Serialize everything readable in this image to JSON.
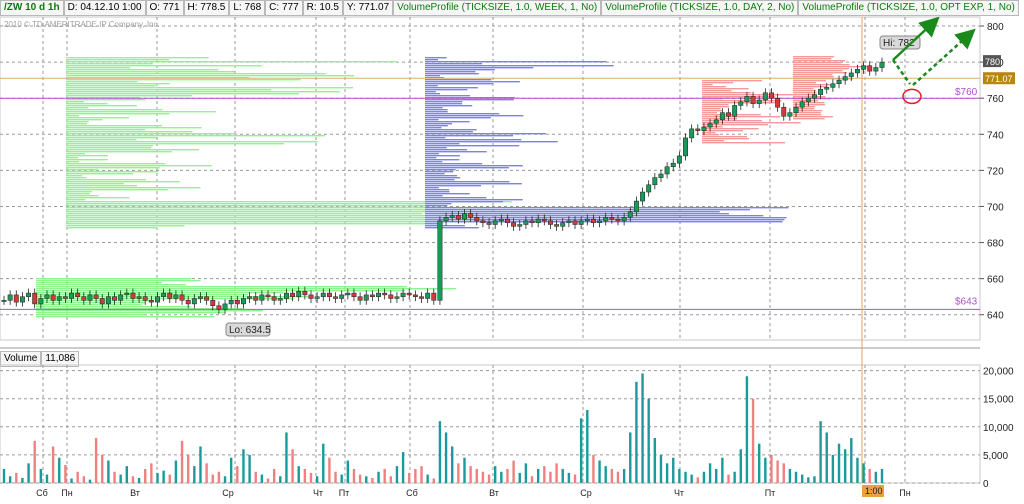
{
  "header": {
    "symbol": "/ZW 10 d 1h",
    "date": "D: 04.12.10 1:00",
    "open": "O: 771",
    "high": "H: 778.5",
    "low": "L: 768",
    "close": "C: 777",
    "range": "R: 10.5",
    "y": "Y: 771.07",
    "studies": [
      "VolumeProfile (TICKSIZE, 1.0, WEEK, 1, No)",
      "VolumeProfile (TICKSIZE, 1.0, DAY, 2, No)",
      "VolumeProfile (TICKSIZE, 1.0, OPT EXP, 1, No)"
    ]
  },
  "watermark": "2010 © TD AMERITRADE IP Company, Inc.",
  "volume_header": {
    "label": "Volume",
    "value": "11,086"
  },
  "annotations": {
    "hi_label": "Hi: 782",
    "lo_label": "Lo: 634.5",
    "price_badge": "771.07",
    "last_badge": "780",
    "level_760": "$760",
    "level_643": "$643",
    "time_badge": "1:00"
  },
  "colors": {
    "green_profile": "#8ef58e",
    "blue_profile": "#7f7ff0",
    "red_profile": "#f59a9a",
    "candle_up": "#1a9a5a",
    "candle_down": "#d23a3a",
    "vol_up": "#1a9a9a",
    "vol_down": "#f08080",
    "level_line": "#b050d0",
    "arrow": "#1a8a1a"
  },
  "chart_data": {
    "type": "candlestick",
    "price_axis": {
      "ticks": [
        640,
        660,
        680,
        700,
        720,
        740,
        760,
        780,
        800
      ],
      "ylim": [
        626,
        805
      ]
    },
    "volume_axis": {
      "ticks": [
        0,
        5000,
        10000,
        15000,
        20000
      ],
      "ticklabels": [
        "0",
        "5,000",
        "10,000",
        "15,000",
        "20,000"
      ],
      "ylim": [
        0,
        21000
      ]
    },
    "x_labels": [
      "Сб",
      "Пн",
      "Вт",
      "Ср",
      "Чт",
      "Пт",
      "Сб",
      "Вт",
      "Ср",
      "Чт",
      "Пт",
      "Пн"
    ],
    "closes": [
      648,
      651,
      647,
      650,
      652,
      646,
      649,
      651,
      648,
      650,
      649,
      652,
      650,
      648,
      651,
      649,
      646,
      650,
      648,
      651,
      652,
      649,
      650,
      648,
      647,
      650,
      652,
      649,
      651,
      648,
      646,
      649,
      650,
      648,
      645,
      643,
      646,
      648,
      646,
      649,
      650,
      648,
      651,
      650,
      648,
      649,
      652,
      650,
      653,
      651,
      649,
      650,
      652,
      650,
      649,
      651,
      652,
      650,
      648,
      651,
      650,
      652,
      651,
      649,
      650,
      652,
      651,
      650,
      649,
      652,
      648,
      692,
      694,
      695,
      693,
      696,
      694,
      692,
      691,
      690,
      692,
      693,
      691,
      689,
      690,
      692,
      691,
      693,
      692,
      690,
      689,
      691,
      692,
      690,
      692,
      693,
      691,
      692,
      694,
      693,
      692,
      694,
      697,
      703,
      708,
      712,
      716,
      718,
      722,
      724,
      728,
      738,
      743,
      742,
      744,
      746,
      748,
      752,
      750,
      756,
      758,
      761,
      757,
      759,
      763,
      760,
      755,
      750,
      752,
      755,
      758,
      760,
      762,
      765,
      766,
      768,
      770,
      772,
      774,
      776,
      778,
      775,
      777,
      780
    ],
    "volumes": [
      2500,
      1200,
      1800,
      900,
      3500,
      7500,
      2500,
      1500,
      6500,
      4500,
      3200,
      800,
      2000,
      1200,
      600,
      8000,
      5000,
      4000,
      2000,
      1500,
      3000,
      1200,
      900,
      2500,
      3500,
      1800,
      2200,
      1500,
      4000,
      7500,
      5000,
      3000,
      6500,
      3500,
      1500,
      2000,
      1200,
      4500,
      3000,
      6000,
      5000,
      2000,
      1500,
      800,
      2500,
      1200,
      9000,
      6000,
      3000,
      2500,
      1800,
      1200,
      7000,
      4500,
      2000,
      1500,
      4000,
      2500,
      1500,
      1200,
      900,
      2000,
      2500,
      1200,
      3000,
      5500,
      1800,
      2500,
      3000,
      1500,
      800,
      11000,
      9000,
      6500,
      3500,
      4500,
      3000,
      2500,
      2000,
      1500,
      3000,
      2000,
      2500,
      4000,
      1800,
      3500,
      1200,
      2500,
      3000,
      2000,
      3500,
      2500,
      1800,
      1500,
      11500,
      13000,
      5000,
      4000,
      3000,
      2500,
      2000,
      2500,
      9000,
      18000,
      19500,
      15000,
      8000,
      5000,
      3500,
      4500,
      2500,
      2000,
      1500,
      1000,
      2000,
      3500,
      2500,
      4500,
      1500,
      2000,
      6000,
      19000,
      15000,
      7000,
      4500,
      5000,
      4000,
      3500,
      2500,
      2000,
      1500,
      1000,
      1200,
      11000,
      9000,
      5000,
      7000,
      6000,
      8000,
      4500,
      3500,
      2500,
      2000,
      2500,
      7000
    ]
  }
}
